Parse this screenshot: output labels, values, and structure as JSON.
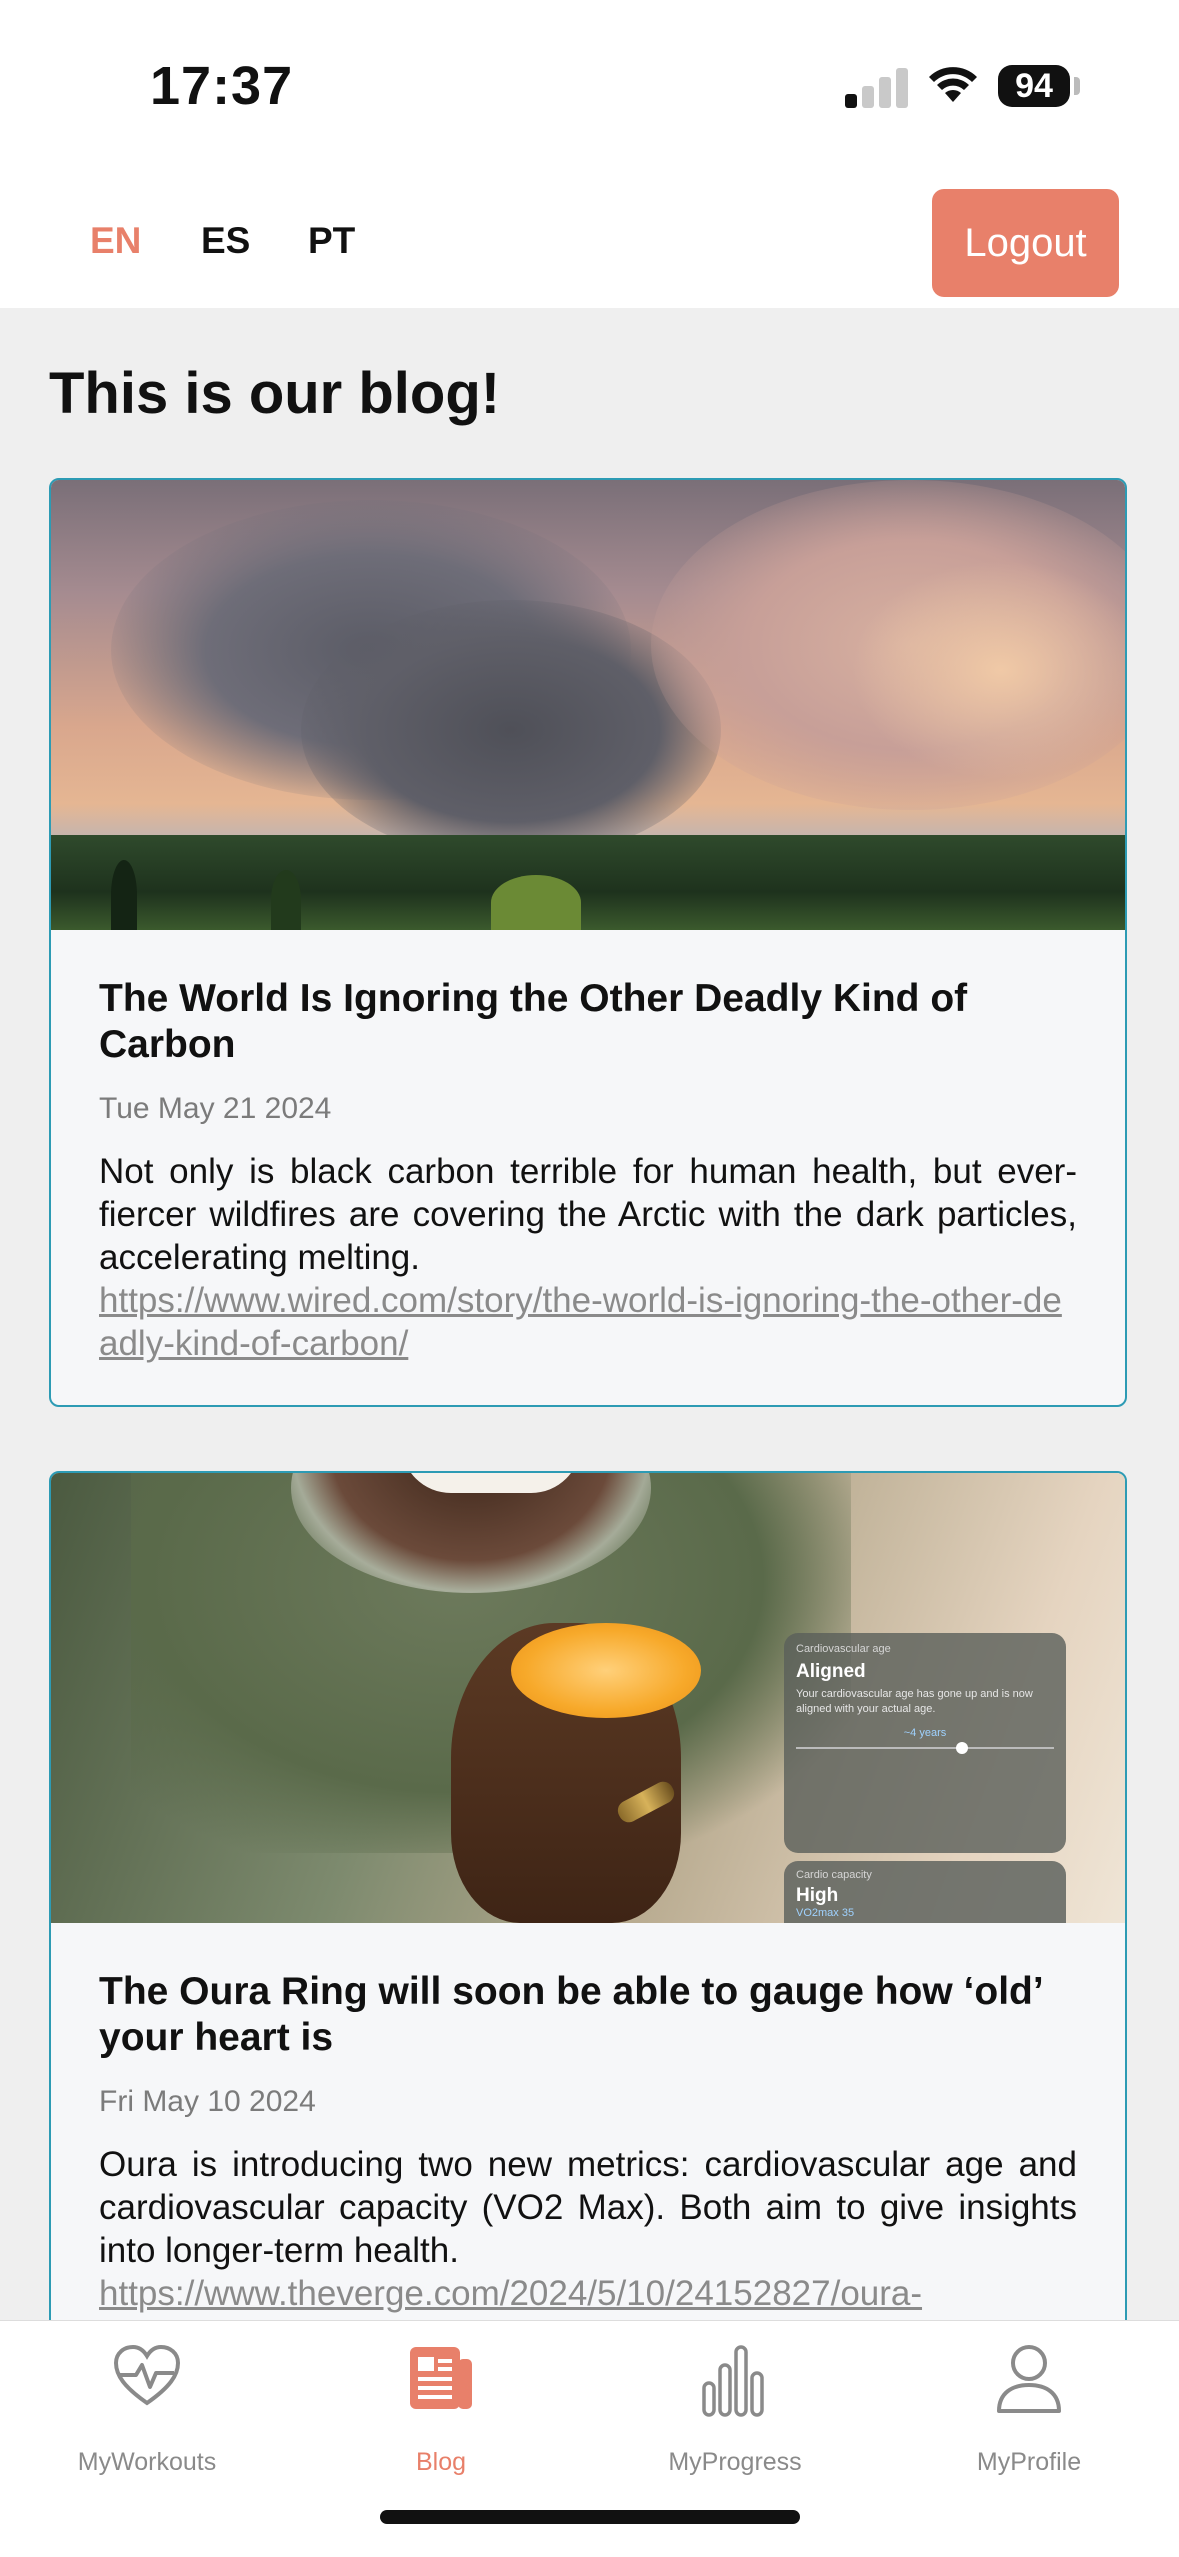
{
  "status_bar": {
    "time": "17:37",
    "battery": "94"
  },
  "header": {
    "languages": [
      {
        "label": "EN",
        "active": true
      },
      {
        "label": "ES",
        "active": false
      },
      {
        "label": "PT",
        "active": false
      }
    ],
    "logout_label": "Logout"
  },
  "page_title": "This is our blog!",
  "posts": [
    {
      "title": "The World Is Ignoring the Other Deadly Kind of Carbon",
      "date": "Tue May 21 2024",
      "description": "Not only is black carbon terrible for human health, but ever-fiercer wildfires are covering the Arctic with the dark particles, accelerating melting.",
      "link": "https://www.wired.com/story/the-world-is-ignoring-the-other-deadly-kind-of-carbon/"
    },
    {
      "title": "The Oura Ring will soon be able to gauge how ‘old’ your heart is",
      "date": "Fri May 10 2024",
      "description": "Oura is introducing two new metrics: cardiovascular age and cardiovascular capacity (VO2 Max). Both aim to give insights into longer-term health.",
      "link": "https://www.theverge.com/2024/5/10/24152827/oura-",
      "image_widget": {
        "card1_label": "Cardiovascular age",
        "card1_title": "Aligned",
        "card1_text": "Your cardiovascular age has gone up and is now aligned with your actual age.",
        "card1_value": "~4 years",
        "card2_label": "Cardio capacity",
        "card2_title": "High",
        "card2_value": "VO2max 35"
      }
    }
  ],
  "tabbar": {
    "tabs": [
      {
        "label": "MyWorkouts",
        "icon": "heartbeat-icon"
      },
      {
        "label": "Blog",
        "icon": "newspaper-icon",
        "active": true
      },
      {
        "label": "MyProgress",
        "icon": "bar-chart-icon"
      },
      {
        "label": "MyProfile",
        "icon": "person-icon"
      }
    ]
  },
  "colors": {
    "accent": "#e8806a",
    "card_border": "#2d9bb4"
  }
}
